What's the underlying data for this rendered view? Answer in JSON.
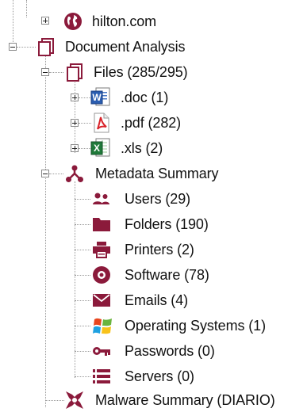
{
  "tree": {
    "hilton": {
      "label": "hilton.com",
      "icon": "globe-icon"
    },
    "document_analysis": {
      "label": "Document Analysis",
      "icon": "document-outline-icon",
      "files": {
        "label": "Files (285/295)",
        "icon": "document-outline-icon",
        "items": [
          {
            "label": ".doc (1)",
            "icon": "word-doc-icon"
          },
          {
            "label": ".pdf (282)",
            "icon": "pdf-icon"
          },
          {
            "label": ".xls (2)",
            "icon": "excel-icon"
          }
        ]
      },
      "metadata": {
        "label": "Metadata Summary",
        "icon": "metadata-nodes-icon",
        "items": [
          {
            "label": "Users (29)",
            "icon": "users-icon"
          },
          {
            "label": "Folders (190)",
            "icon": "folder-icon"
          },
          {
            "label": "Printers (2)",
            "icon": "printer-icon"
          },
          {
            "label": "Software (78)",
            "icon": "software-disc-icon"
          },
          {
            "label": "Emails (4)",
            "icon": "email-icon"
          },
          {
            "label": "Operating Systems (1)",
            "icon": "windows-logo-icon"
          },
          {
            "label": "Passwords (0)",
            "icon": "key-icon"
          },
          {
            "label": "Servers (0)",
            "icon": "server-list-icon"
          }
        ]
      },
      "malware": {
        "label": "Malware Summary (DIARIO)",
        "icon": "malware-icon"
      }
    }
  },
  "colors": {
    "accent": "#8b1a3b",
    "tree_lines": "#9a9a9a"
  }
}
